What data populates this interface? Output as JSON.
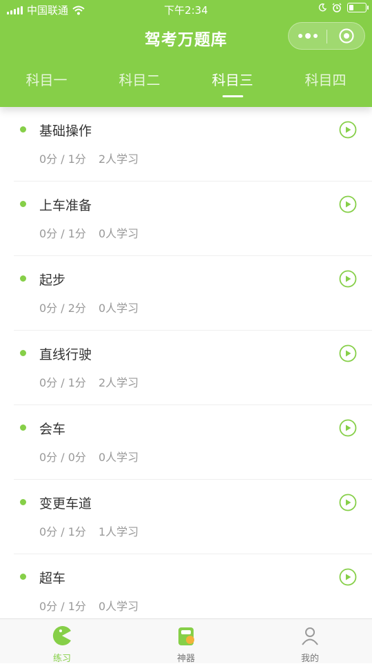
{
  "status_bar": {
    "carrier": "中国联通",
    "time": "下午2:34"
  },
  "nav": {
    "title": "驾考万题库"
  },
  "tabs": [
    {
      "label": "科目一"
    },
    {
      "label": "科目二"
    },
    {
      "label": "科目三"
    },
    {
      "label": "科目四"
    }
  ],
  "active_tab": 2,
  "items": [
    {
      "title": "基础操作",
      "score": "0分 / 1分",
      "learners": "2人学习"
    },
    {
      "title": "上车准备",
      "score": "0分 / 1分",
      "learners": "0人学习"
    },
    {
      "title": "起步",
      "score": "0分 / 2分",
      "learners": "0人学习"
    },
    {
      "title": "直线行驶",
      "score": "0分 / 1分",
      "learners": "2人学习"
    },
    {
      "title": "会车",
      "score": "0分 / 0分",
      "learners": "0人学习"
    },
    {
      "title": "变更车道",
      "score": "0分 / 1分",
      "learners": "1人学习"
    },
    {
      "title": "超车",
      "score": "0分 / 1分",
      "learners": "0人学习"
    }
  ],
  "tabbar": [
    {
      "label": "练习",
      "icon": "pacman-icon"
    },
    {
      "label": "神器",
      "icon": "toolbox-icon"
    },
    {
      "label": "我的",
      "icon": "user-icon"
    }
  ],
  "colors": {
    "brand": "#86cf48",
    "text": "#333333",
    "muted": "#999999"
  }
}
